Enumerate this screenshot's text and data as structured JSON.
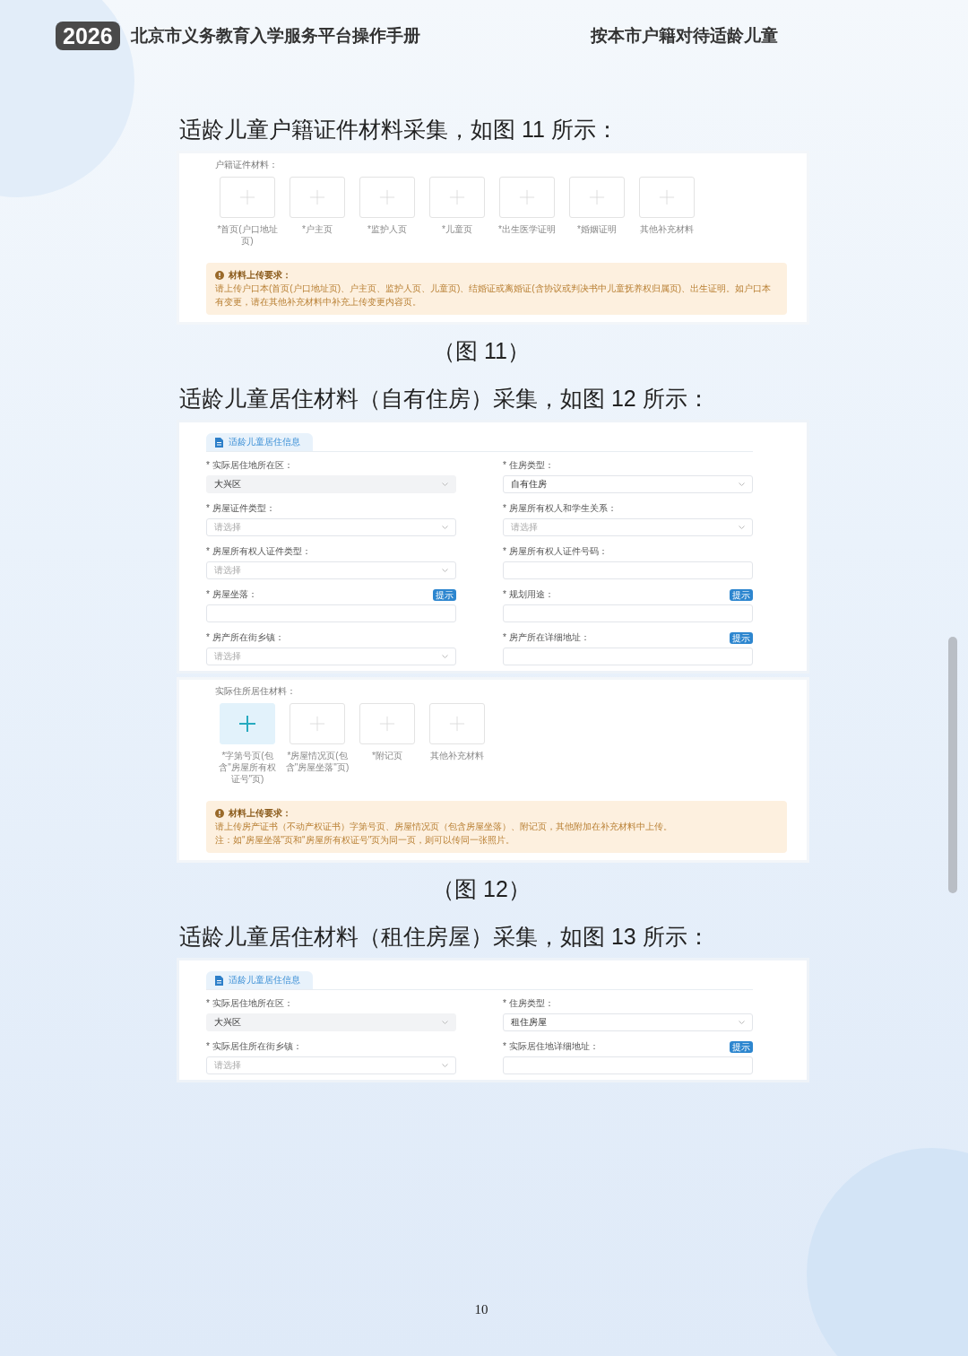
{
  "header": {
    "badge": "2026",
    "title": "北京市义务教育入学服务平台操作手册",
    "section": "按本市户籍对待适龄儿童"
  },
  "blocks": [
    {
      "kind": "heading",
      "text": "适龄儿童户籍证件材料采集，如图 11 所示："
    },
    {
      "kind": "upload",
      "label": "户籍证件材料：",
      "tiles": [
        {
          "caption": "*首页(户口地址页)",
          "active": false
        },
        {
          "caption": "*户主页",
          "active": false
        },
        {
          "caption": "*监护人页",
          "active": false
        },
        {
          "caption": "*儿童页",
          "active": false
        },
        {
          "caption": "*出生医学证明",
          "active": false
        },
        {
          "caption": "*婚姻证明",
          "active": false
        },
        {
          "caption": "其他补充材料",
          "active": false
        }
      ],
      "notice": {
        "title": "材料上传要求：",
        "lines": [
          "请上传户口本(首页(户口地址页)、户主页、监护人页、儿童页)、结婚证或离婚证(含协议或判决书中儿童抚养权归属页)、出生证明。如户口本有变更，请在其他补充材料中补充上传变更内容页。"
        ]
      }
    },
    {
      "kind": "caption",
      "text": "（图 11）"
    },
    {
      "kind": "heading",
      "text": "适龄儿童居住材料（自有住房）采集，如图 12 所示："
    },
    {
      "kind": "form",
      "tab": "适龄儿童居住信息",
      "fields": [
        {
          "label": "* 实际居住地所在区：",
          "kind": "select",
          "value": "大兴区",
          "disabled": true
        },
        {
          "label": "* 住房类型：",
          "kind": "select",
          "value": "自有住房",
          "disabled": false
        },
        {
          "label": "* 房屋证件类型：",
          "kind": "select",
          "placeholder": "请选择",
          "disabled": false
        },
        {
          "label": "* 房屋所有权人和学生关系：",
          "kind": "select",
          "placeholder": "请选择",
          "disabled": false
        },
        {
          "label": "* 房屋所有权人证件类型：",
          "kind": "select",
          "placeholder": "请选择",
          "disabled": false
        },
        {
          "label": "* 房屋所有权人证件号码：",
          "kind": "input",
          "disabled": false
        },
        {
          "label": "* 房屋坐落：",
          "kind": "input",
          "hint": "提示",
          "disabled": false
        },
        {
          "label": "* 规划用途：",
          "kind": "input",
          "hint": "提示",
          "disabled": false
        },
        {
          "label": "* 房产所在街乡镇：",
          "kind": "select",
          "placeholder": "请选择",
          "disabled": false
        },
        {
          "label": "* 房产所在详细地址：",
          "kind": "input",
          "hint": "提示",
          "disabled": false
        }
      ]
    },
    {
      "kind": "upload",
      "label": "实际住所居住材料：",
      "tiles": [
        {
          "caption": "*字第号页(包含\"房屋所有权证号\"页)",
          "active": true
        },
        {
          "caption": "*房屋情况页(包含\"房屋坐落\"页)",
          "active": false
        },
        {
          "caption": "*附记页",
          "active": false
        },
        {
          "caption": "其他补充材料",
          "active": false
        }
      ],
      "notice": {
        "title": "材料上传要求：",
        "lines": [
          "请上传房产证书（不动产权证书）字第号页、房屋情况页（包含房屋坐落）、附记页，其他附加在补充材料中上传。",
          "注：如\"房屋坐落\"页和\"房屋所有权证号\"页为同一页，则可以传同一张照片。"
        ]
      }
    },
    {
      "kind": "caption",
      "text": "（图 12）"
    },
    {
      "kind": "heading",
      "text": "适龄儿童居住材料（租住房屋）采集，如图 13 所示："
    },
    {
      "kind": "form",
      "tab": "适龄儿童居住信息",
      "fields": [
        {
          "label": "* 实际居住地所在区：",
          "kind": "select",
          "value": "大兴区",
          "disabled": true
        },
        {
          "label": "* 住房类型：",
          "kind": "select",
          "value": "租住房屋",
          "disabled": false
        },
        {
          "label": "* 实际居住所在街乡镇：",
          "kind": "select",
          "placeholder": "请选择",
          "disabled": false
        },
        {
          "label": "* 实际居住地详细地址：",
          "kind": "input",
          "hint": "提示",
          "disabled": false
        }
      ]
    }
  ],
  "page_number": "10"
}
